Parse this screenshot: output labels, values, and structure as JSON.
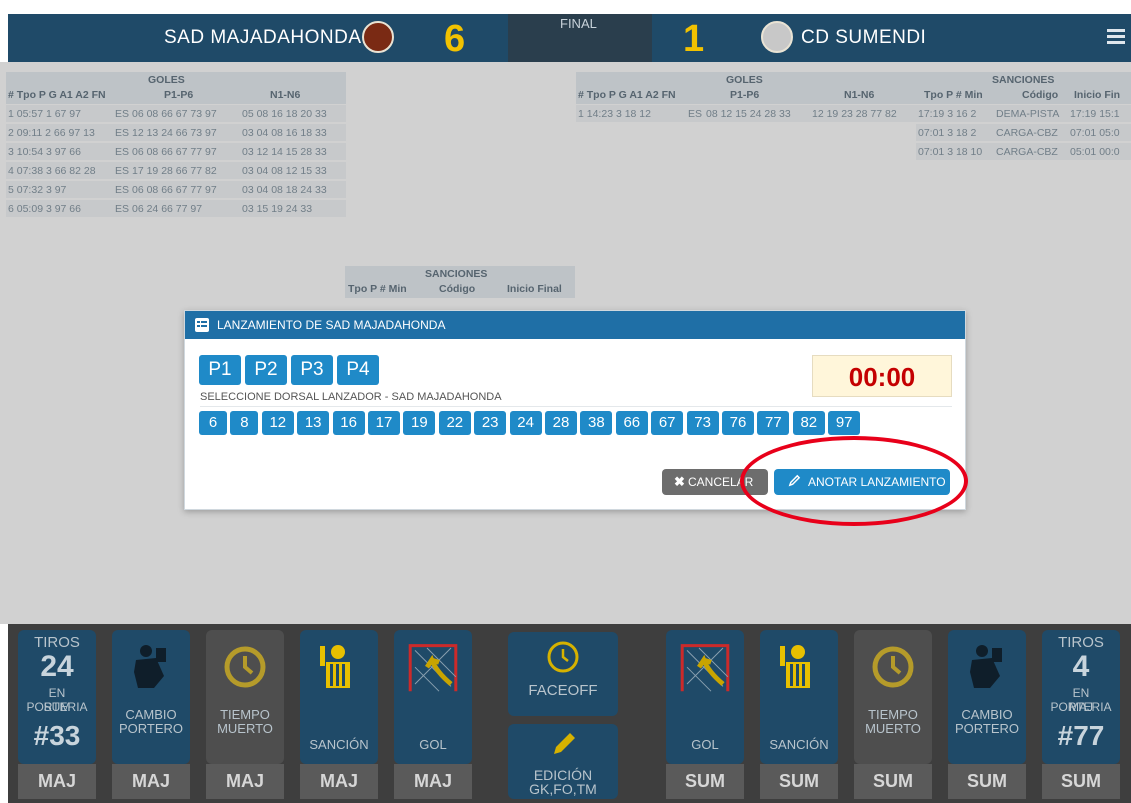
{
  "header": {
    "home_team": "SAD MAJADAHONDA",
    "home_score": "6",
    "status": "FINAL",
    "away_score": "1",
    "away_team": "CD SUMENDI"
  },
  "left_stats": {
    "goles_label": "GOLES",
    "columns": "# Tpo P G A1 A2 FN",
    "p_header": "P1-P6",
    "n_header": "N1-N6",
    "rows": [
      {
        "info": "1 05:57 1 67 97",
        "fn": "ES",
        "p": "06 08 66 67 73 97",
        "n": "05 08 16 18 20 33"
      },
      {
        "info": "2 09:11 2 66 97 13",
        "fn": "ES",
        "p": "12 13 24 66 73 97",
        "n": "03 04 08 16 18 33"
      },
      {
        "info": "3 10:54 3 97 66",
        "fn": "ES",
        "p": "06 08 66 67 77 97",
        "n": "03 12 14 15 28 33"
      },
      {
        "info": "4 07:38 3 66 82 28",
        "fn": "ES",
        "p": "17 19 28 66 77 82",
        "n": "03 04 08 12 15 33"
      },
      {
        "info": "5 07:32 3 97",
        "fn": "ES",
        "p": "06 08 66 67 77 97",
        "n": "03 04 08 18 24 33"
      },
      {
        "info": "6 05:09 3 97 66",
        "fn": "ES",
        "p": "06 24 66 77 97",
        "n": "03 15 19 24 33"
      }
    ]
  },
  "mid_sanciones": {
    "title": "SANCIONES",
    "columns": "Tpo P # Min",
    "codigo": "Código",
    "inicio_final": "Inicio Final"
  },
  "right_stats": {
    "goles_label": "GOLES",
    "columns": "# Tpo P G A1 A2 FN",
    "p_header": "P1-P6",
    "n_header": "N1-N6",
    "rows": [
      {
        "info": "1 14:23 3 18 12",
        "fn": "ES",
        "p": "08 12 15 24 28 33",
        "n": "12 19 23 28 77 82"
      }
    ]
  },
  "right_sanciones": {
    "title": "SANCIONES",
    "columns": "Tpo P # Min",
    "codigo": "Código",
    "inicio_final": "Inicio Fin",
    "rows": [
      {
        "info": "17:19 3 16 2",
        "codigo": "DEMA-PISTA",
        "inicio": "17:19 15:1"
      },
      {
        "info": "07:01 3 18 2",
        "codigo": "CARGA-CBZ",
        "inicio": "07:01 05:0"
      },
      {
        "info": "07:01 3 18 10",
        "codigo": "CARGA-CBZ",
        "inicio": "05:01 00:0"
      }
    ]
  },
  "dialog": {
    "title": "LANZAMIENTO DE SAD MAJADAHONDA",
    "periods": [
      "P1",
      "P2",
      "P3",
      "P4"
    ],
    "timer": "00:00",
    "select_label": "SELECCIONE DORSAL LANZADOR - SAD MAJADAHONDA",
    "dorsales": [
      "6",
      "8",
      "12",
      "13",
      "16",
      "17",
      "19",
      "22",
      "23",
      "24",
      "28",
      "38",
      "66",
      "67",
      "73",
      "76",
      "77",
      "82",
      "97"
    ],
    "cancel_label": "CANCELAR",
    "confirm_label": "ANOTAR LANZAMIENTO"
  },
  "toolbar": {
    "tiros_sum": {
      "title": "TIROS",
      "count": "24",
      "sub1": "EN PORTERIA",
      "sub2": "SUM",
      "dorsal": "#33"
    },
    "cambio_portero": "CAMBIO PORTERO",
    "tiempo_muerto": "TIEMPO MUERTO",
    "sancion": "SANCIÓN",
    "gol": "GOL",
    "faceoff": "FACEOFF",
    "edicion": "EDICIÓN GK,FO,TM",
    "tiros_maj": {
      "title": "TIROS",
      "count": "4",
      "sub1": "EN PORTERIA",
      "sub2": "MAJ",
      "dorsal": "#77"
    },
    "team_left": "MAJ",
    "team_right": "SUM"
  },
  "colors": {
    "header_bg": "#1f4a68",
    "score": "#f2c200",
    "accent": "#1f8ac8",
    "timer": "#c40000",
    "highlight_circle": "#e8001a"
  }
}
